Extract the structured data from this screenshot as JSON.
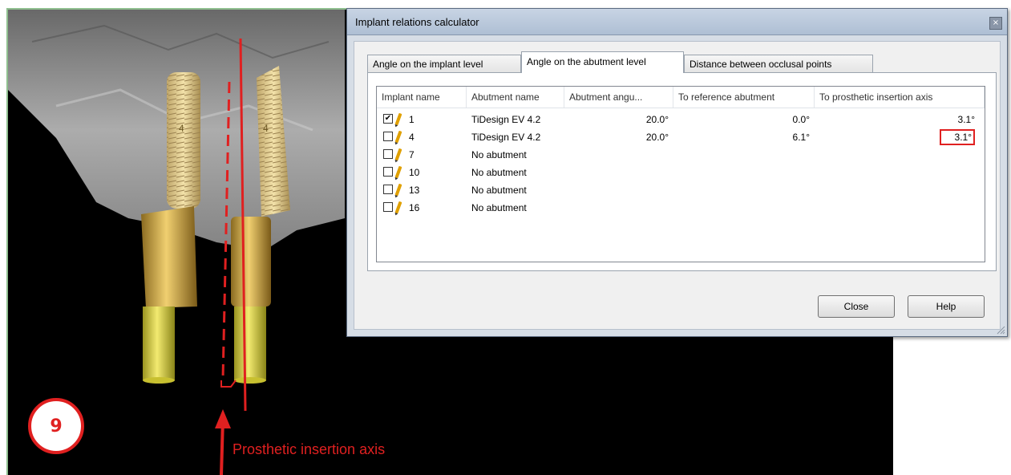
{
  "dialog": {
    "title": "Implant relations calculator",
    "close_glyph": "×",
    "tabs": [
      {
        "label": "Angle on the implant level",
        "active": false
      },
      {
        "label": "Angle on the abutment level",
        "active": true
      },
      {
        "label": "Distance between occlusal points",
        "active": false
      }
    ],
    "columns": [
      "Implant name",
      "Abutment name",
      "Abutment angu...",
      "To reference abutment",
      "To prosthetic insertion axis"
    ],
    "rows": [
      {
        "checked": true,
        "implant": "1",
        "abutment": "TiDesign EV 4.2",
        "angle": "20.0°",
        "to_reference": "0.0°",
        "to_axis": "3.1°"
      },
      {
        "checked": false,
        "implant": "4",
        "abutment": "TiDesign EV 4.2",
        "angle": "20.0°",
        "to_reference": "6.1°",
        "to_axis": "3.1°"
      },
      {
        "checked": false,
        "implant": "7",
        "abutment": "No abutment",
        "angle": "",
        "to_reference": "",
        "to_axis": ""
      },
      {
        "checked": false,
        "implant": "10",
        "abutment": "No abutment",
        "angle": "",
        "to_reference": "",
        "to_axis": ""
      },
      {
        "checked": false,
        "implant": "13",
        "abutment": "No abutment",
        "angle": "",
        "to_reference": "",
        "to_axis": ""
      },
      {
        "checked": false,
        "implant": "16",
        "abutment": "No abutment",
        "angle": "",
        "to_reference": "",
        "to_axis": ""
      }
    ],
    "close_label": "Close",
    "help_label": "Help"
  },
  "viewport": {
    "step_number": "9",
    "axis_caption": "Prosthetic insertion axis",
    "implant_labels": [
      "4",
      "4"
    ]
  },
  "colors": {
    "annotation_red": "#e02020",
    "implant_gold": "#d9b040",
    "abutment_yellow": "#e6dc50",
    "bone_gray": "#9a9a9a"
  }
}
